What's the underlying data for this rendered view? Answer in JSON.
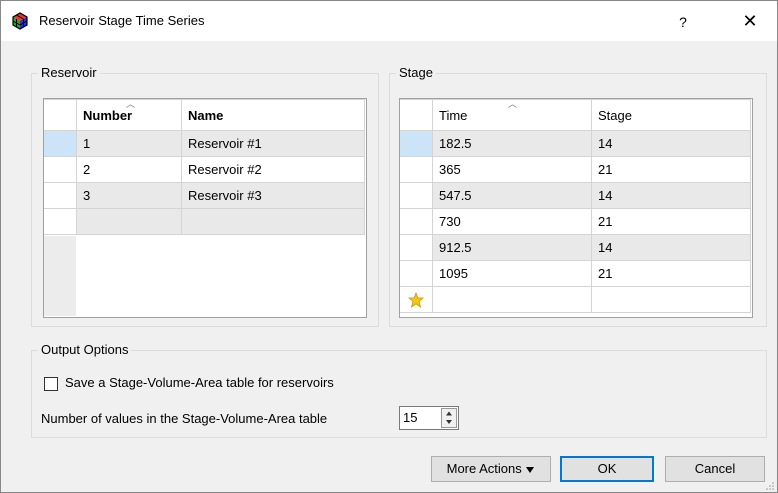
{
  "window": {
    "title": "Reservoir Stage Time Series",
    "help_label": "?",
    "close_label": "✕"
  },
  "reservoir": {
    "group_label": "Reservoir",
    "columns": [
      "Number",
      "Name"
    ],
    "rows": [
      [
        "1",
        "Reservoir #1"
      ],
      [
        "2",
        "Reservoir #2"
      ],
      [
        "3",
        "Reservoir #3"
      ]
    ]
  },
  "stage": {
    "group_label": "Stage",
    "columns": [
      "Time",
      "Stage"
    ],
    "rows": [
      [
        "182.5",
        "14"
      ],
      [
        "365",
        "21"
      ],
      [
        "547.5",
        "14"
      ],
      [
        "730",
        "21"
      ],
      [
        "912.5",
        "14"
      ],
      [
        "1095",
        "21"
      ]
    ]
  },
  "output": {
    "group_label": "Output Options",
    "save_checkbox_label": "Save a Stage-Volume-Area table for reservoirs",
    "save_checked": false,
    "num_values_label": "Number of values in the Stage-Volume-Area table",
    "num_values": "15"
  },
  "buttons": {
    "more_actions": "More Actions",
    "ok": "OK",
    "cancel": "Cancel"
  },
  "icons": {
    "new_row": "star-icon",
    "dropdown": "triangle-down-icon",
    "sort": "sort-ascending-icon"
  }
}
